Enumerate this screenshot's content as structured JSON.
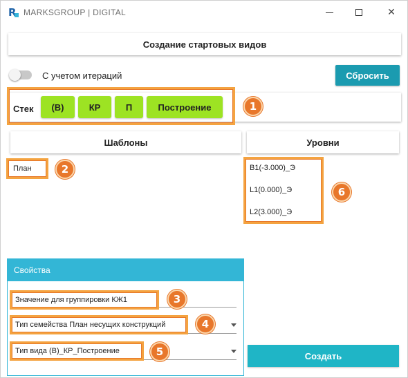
{
  "window": {
    "title": "MARKSGROUP | DIGITAL",
    "icon_letter": "R",
    "controls": {
      "minimize": "minimize-icon",
      "maximize": "maximize-icon",
      "close": "✕"
    }
  },
  "header": {
    "title": "Создание стартовых видов"
  },
  "options": {
    "iterations_toggle_label": "С учетом итераций",
    "iterations_on": false
  },
  "toolbar": {
    "reset_label": "Сбросить"
  },
  "stack": {
    "label": "Стек",
    "chips": [
      "(В)",
      "КР",
      "П",
      "Построение"
    ],
    "chip_color": "#9de323"
  },
  "sections": {
    "templates": "Шаблоны",
    "levels": "Уровни"
  },
  "templates": [
    "План"
  ],
  "levels": [
    "В1(-3.000)_Э",
    "L1(0.000)_Э",
    "L2(3.000)_Э"
  ],
  "properties": {
    "header": "Свойства",
    "group_value": "Значение для группировки  КЖ1",
    "family_type": "Тип семейства  План несущих конструкций",
    "view_type": "Тип вида  (В)_КР_Построение"
  },
  "actions": {
    "create_label": "Создать"
  },
  "badges": [
    "1",
    "2",
    "3",
    "4",
    "5",
    "6"
  ],
  "colors": {
    "accent_teal": "#1b9bb0",
    "panel_blue": "#33b6d6",
    "highlight_orange": "#f4a340",
    "badge_orange": "#e8772b"
  }
}
